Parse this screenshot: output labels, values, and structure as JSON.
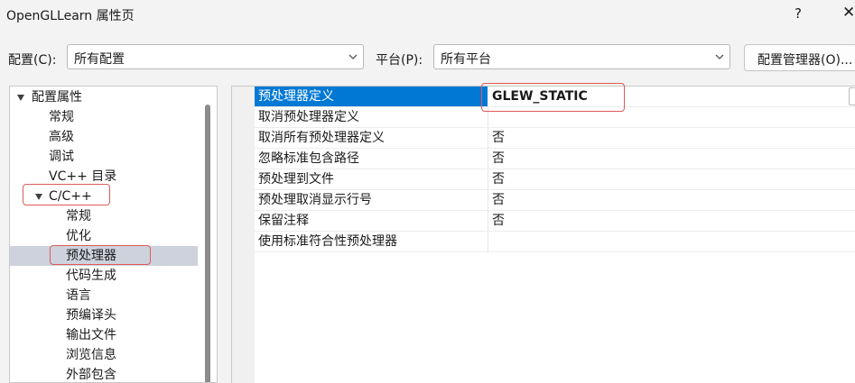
{
  "window": {
    "title": "OpenGLLearn 属性页",
    "help_label": "?",
    "close_label": "✕"
  },
  "toolbar": {
    "config_label": "配置(C):",
    "config_value": "所有配置",
    "platform_label": "平台(P):",
    "platform_value": "所有平台",
    "config_manager_label": "配置管理器(O)..."
  },
  "tree": {
    "items": [
      {
        "label": "配置属性"
      },
      {
        "label": "常规"
      },
      {
        "label": "高级"
      },
      {
        "label": "调试"
      },
      {
        "label": "VC++ 目录"
      },
      {
        "label": "C/C++"
      },
      {
        "label": "常规"
      },
      {
        "label": "优化"
      },
      {
        "label": "预处理器"
      },
      {
        "label": "代码生成"
      },
      {
        "label": "语言"
      },
      {
        "label": "预编译头"
      },
      {
        "label": "输出文件"
      },
      {
        "label": "浏览信息"
      },
      {
        "label": "外部包含"
      }
    ],
    "selected_item": "预处理器"
  },
  "properties": {
    "rows": [
      {
        "name": "预处理器定义",
        "value": "GLEW_STATIC"
      },
      {
        "name": "取消预处理器定义",
        "value": ""
      },
      {
        "name": "取消所有预处理器定义",
        "value": "否"
      },
      {
        "name": "忽略标准包含路径",
        "value": "否"
      },
      {
        "name": "预处理到文件",
        "value": "否"
      },
      {
        "name": "预处理取消显示行号",
        "value": "否"
      },
      {
        "name": "保留注释",
        "value": "否"
      },
      {
        "name": "使用标准符合性预处理器",
        "value": ""
      }
    ],
    "selected_row": "预处理器定义"
  },
  "colors": {
    "selection_blue": "#0078d4",
    "tree_selection": "#cdd2dc",
    "annotation_red": "#e05a5a"
  }
}
